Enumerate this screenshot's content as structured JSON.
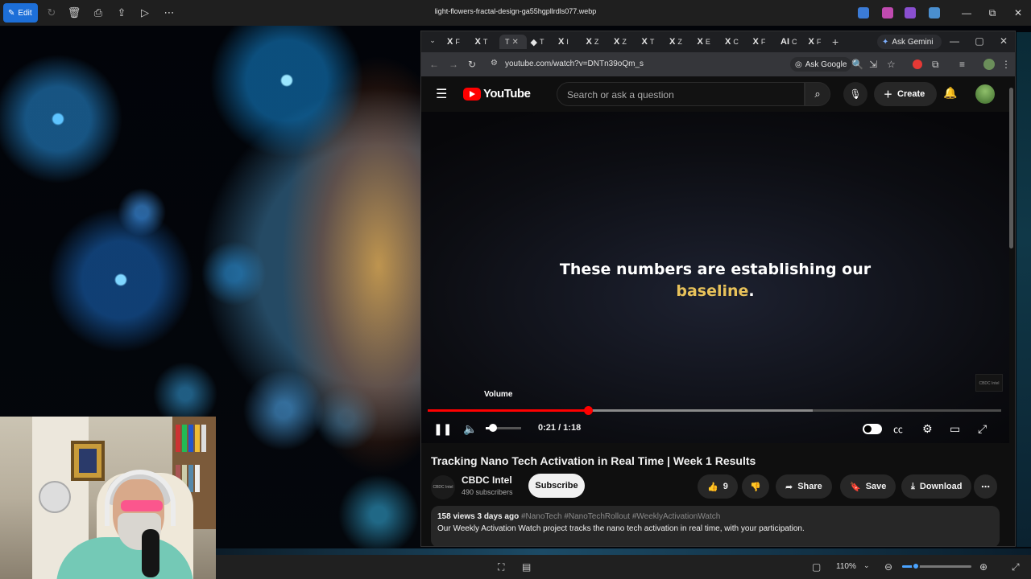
{
  "photos_app": {
    "edit_label": "Edit",
    "filename": "light-flowers-fractal-design-ga55hgpllrdls077.webp",
    "zoom_level": "110%",
    "zoom_fraction": 0.2
  },
  "browser": {
    "tabs": [
      {
        "glyph": "X",
        "label": "F"
      },
      {
        "glyph": "X",
        "label": "T"
      },
      {
        "glyph": "",
        "label": "T",
        "active": true
      },
      {
        "glyph": "◆",
        "label": "T"
      },
      {
        "glyph": "X",
        "label": "I"
      },
      {
        "glyph": "X",
        "label": "Z"
      },
      {
        "glyph": "X",
        "label": "Z"
      },
      {
        "glyph": "X",
        "label": "T"
      },
      {
        "glyph": "X",
        "label": "Z"
      },
      {
        "glyph": "X",
        "label": "E"
      },
      {
        "glyph": "X",
        "label": "C"
      },
      {
        "glyph": "X",
        "label": "F"
      },
      {
        "glyph": "AI",
        "label": "C"
      },
      {
        "glyph": "X",
        "label": "F"
      }
    ],
    "gemini_label": "Ask Gemini",
    "url": "youtube.com/watch?v=DNTn39oQm_s",
    "ask_google_label": "Ask Google"
  },
  "youtube": {
    "logo_text": "YouTube",
    "search_placeholder": "Search or ask a question",
    "create_label": "Create",
    "video": {
      "caption_line1": "These numbers are establishing our",
      "caption_highlight": "baseline",
      "caption_suffix": ".",
      "watermark": "CBDC Intel",
      "volume_tooltip": "Volume",
      "current_time": "0:21",
      "duration": "1:18",
      "time_display": "0:21 / 1:18",
      "played_fraction": 0.28,
      "buffered_fraction": 0.672,
      "volume_fraction": 0.2
    },
    "title": "Tracking Nano Tech Activation in Real Time | Week 1 Results",
    "channel": {
      "name": "CBDC Intel",
      "subscribers": "490 subscribers",
      "avatar_text": "CBDC Intel"
    },
    "subscribe_label": "Subscribe",
    "like_count": "9",
    "share_label": "Share",
    "save_label": "Save",
    "download_label": "Download",
    "description": {
      "meta": "158 views  3 days ago",
      "tags": "#NanoTech #NanoTechRollout #WeeklyActivationWatch",
      "text": "Our Weekly Activation Watch project tracks the nano tech activation in real time, with your participation."
    }
  }
}
